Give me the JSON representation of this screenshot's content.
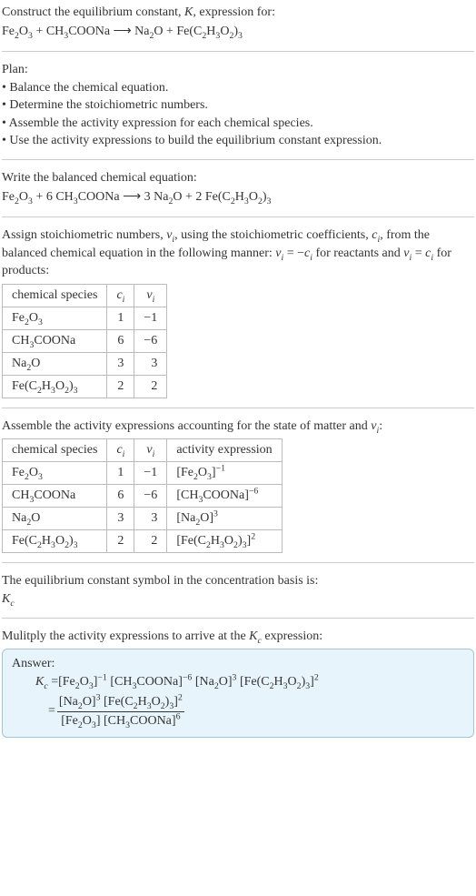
{
  "intro": {
    "line1_pre": "Construct the equilibrium constant, ",
    "line1_K": "K",
    "line1_post": ", expression for:",
    "reaction_unbalanced_html": "Fe<sub>2</sub>O<sub>3</sub> + CH<sub>3</sub>COONa  ⟶  Na<sub>2</sub>O + Fe(C<sub>2</sub>H<sub>3</sub>O<sub>2</sub>)<sub>3</sub>"
  },
  "plan": {
    "title": "Plan:",
    "items": [
      "Balance the chemical equation.",
      "Determine the stoichiometric numbers.",
      "Assemble the activity expression for each chemical species.",
      "Use the activity expressions to build the equilibrium constant expression."
    ]
  },
  "balanced": {
    "title": "Write the balanced chemical equation:",
    "reaction_html": "Fe<sub>2</sub>O<sub>3</sub> + 6 CH<sub>3</sub>COONa  ⟶  3 Na<sub>2</sub>O + 2 Fe(C<sub>2</sub>H<sub>3</sub>O<sub>2</sub>)<sub>3</sub>"
  },
  "assign": {
    "text_html": "Assign stoichiometric numbers, <i>ν<sub>i</sub></i>, using the stoichiometric coefficients, <i>c<sub>i</sub></i>, from the balanced chemical equation in the following manner: <i>ν<sub>i</sub></i> = −<i>c<sub>i</sub></i> for reactants and <i>ν<sub>i</sub></i> = <i>c<sub>i</sub></i> for products:"
  },
  "table1": {
    "headers": {
      "species": "chemical species",
      "ci_html": "<i>c<sub>i</sub></i>",
      "vi_html": "<i>ν<sub>i</sub></i>"
    },
    "rows": [
      {
        "species_html": "Fe<sub>2</sub>O<sub>3</sub>",
        "c": "1",
        "v": "−1"
      },
      {
        "species_html": "CH<sub>3</sub>COONa",
        "c": "6",
        "v": "−6"
      },
      {
        "species_html": "Na<sub>2</sub>O",
        "c": "3",
        "v": "3"
      },
      {
        "species_html": "Fe(C<sub>2</sub>H<sub>3</sub>O<sub>2</sub>)<sub>3</sub>",
        "c": "2",
        "v": "2"
      }
    ]
  },
  "assemble": {
    "text_html": "Assemble the activity expressions accounting for the state of matter and <i>ν<sub>i</sub></i>:"
  },
  "table2": {
    "headers": {
      "species": "chemical species",
      "ci_html": "<i>c<sub>i</sub></i>",
      "vi_html": "<i>ν<sub>i</sub></i>",
      "activity": "activity expression"
    },
    "rows": [
      {
        "species_html": "Fe<sub>2</sub>O<sub>3</sub>",
        "c": "1",
        "v": "−1",
        "activity_html": "[Fe<sub>2</sub>O<sub>3</sub>]<sup>−1</sup>"
      },
      {
        "species_html": "CH<sub>3</sub>COONa",
        "c": "6",
        "v": "−6",
        "activity_html": "[CH<sub>3</sub>COONa]<sup>−6</sup>"
      },
      {
        "species_html": "Na<sub>2</sub>O",
        "c": "3",
        "v": "3",
        "activity_html": "[Na<sub>2</sub>O]<sup>3</sup>"
      },
      {
        "species_html": "Fe(C<sub>2</sub>H<sub>3</sub>O<sub>2</sub>)<sub>3</sub>",
        "c": "2",
        "v": "2",
        "activity_html": "[Fe(C<sub>2</sub>H<sub>3</sub>O<sub>2</sub>)<sub>3</sub>]<sup>2</sup>"
      }
    ]
  },
  "kc_symbol": {
    "line1": "The equilibrium constant symbol in the concentration basis is:",
    "symbol_html": "<i>K<sub>c</sub></i>"
  },
  "multiply": {
    "text_html": "Mulitply the activity expressions to arrive at the <i>K<sub>c</sub></i> expression:"
  },
  "answer": {
    "label": "Answer:",
    "lhs_html": "<i>K<sub>c</sub></i> = ",
    "product_html": "[Fe<sub>2</sub>O<sub>3</sub>]<sup>−1</sup> [CH<sub>3</sub>COONa]<sup>−6</sup> [Na<sub>2</sub>O]<sup>3</sup> [Fe(C<sub>2</sub>H<sub>3</sub>O<sub>2</sub>)<sub>3</sub>]<sup>2</sup>",
    "eq_html": " = ",
    "frac_num_html": "[Na<sub>2</sub>O]<sup>3</sup> [Fe(C<sub>2</sub>H<sub>3</sub>O<sub>2</sub>)<sub>3</sub>]<sup>2</sup>",
    "frac_den_html": "[Fe<sub>2</sub>O<sub>3</sub>] [CH<sub>3</sub>COONa]<sup>6</sup>"
  }
}
